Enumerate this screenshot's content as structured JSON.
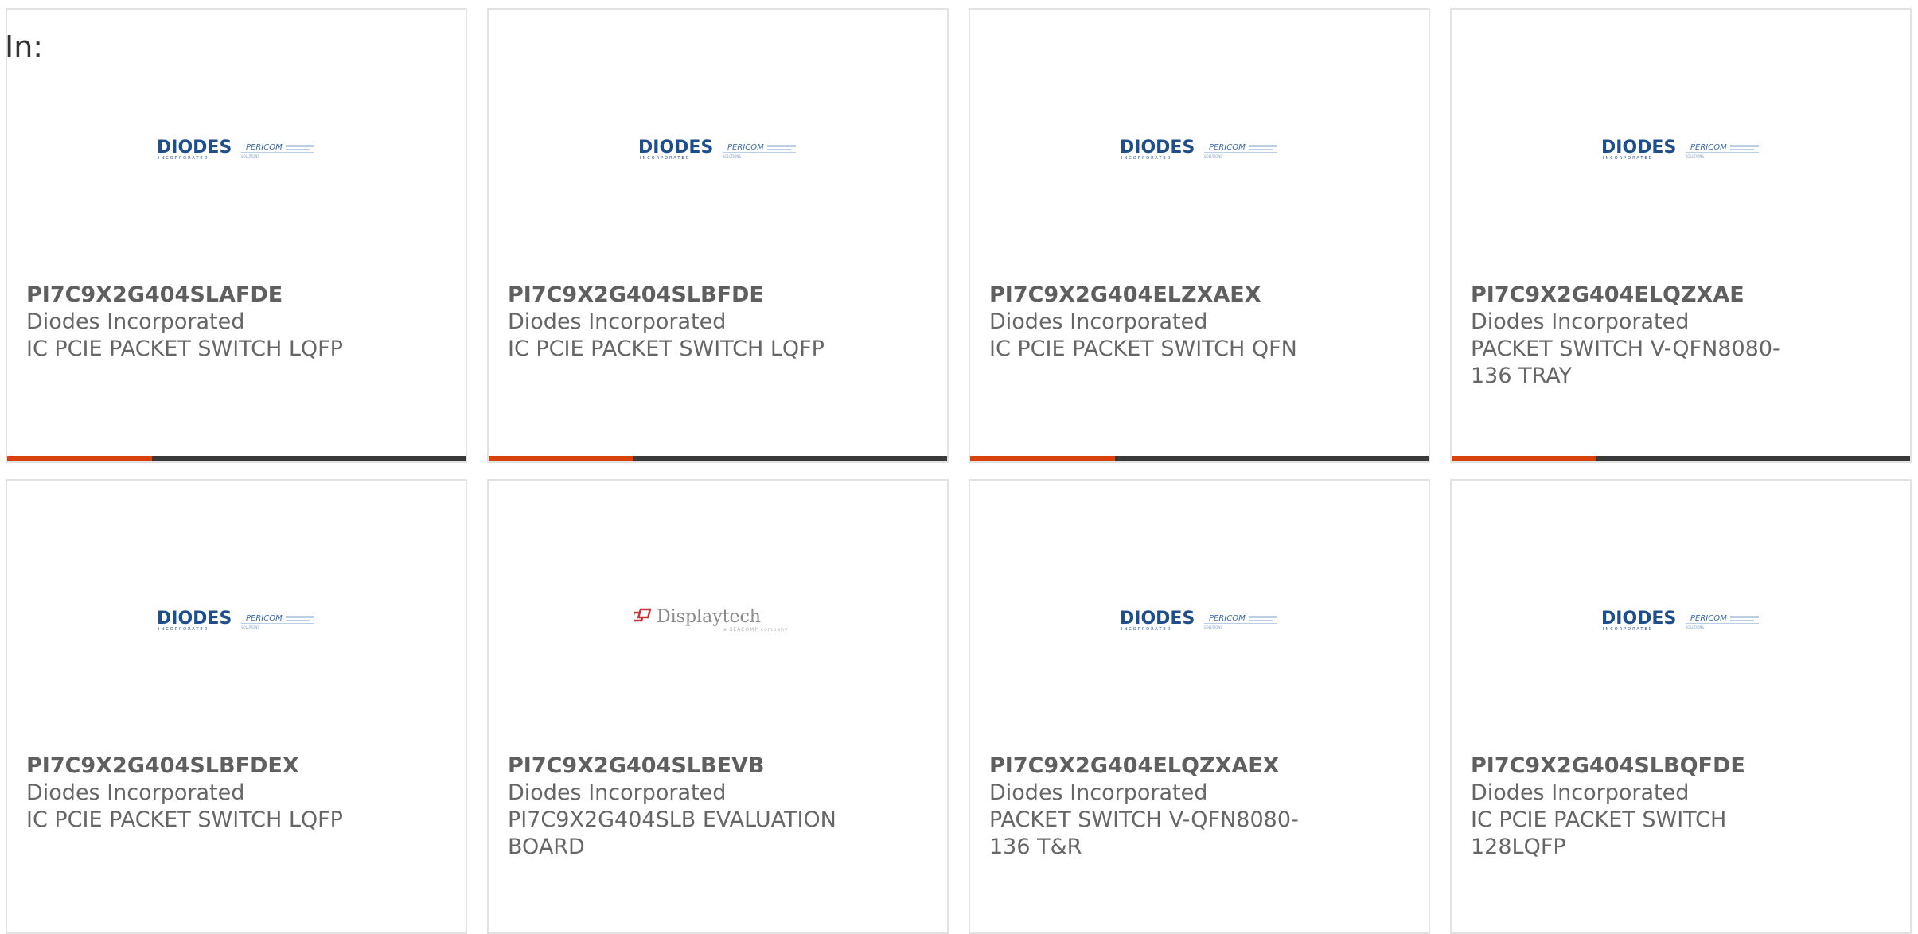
{
  "header": {
    "in_label": "In:"
  },
  "colors": {
    "accent_bar": "#d9400c",
    "dark_bar": "#3a3a3a",
    "diodes_blue": "#1f4e8c",
    "displaytech_red": "#c8323a"
  },
  "products": [
    {
      "part": "PI7C9X2G404SLAFDE",
      "manufacturer": "Diodes Incorporated",
      "description": "IC PCIE PACKET SWITCH LQFP",
      "logo": "diodes-pericom-logo"
    },
    {
      "part": "PI7C9X2G404SLBFDE",
      "manufacturer": "Diodes Incorporated",
      "description": "IC PCIE PACKET SWITCH LQFP",
      "logo": "diodes-pericom-logo"
    },
    {
      "part": "PI7C9X2G404ELZXAEX",
      "manufacturer": "Diodes Incorporated",
      "description": "IC PCIE PACKET SWITCH QFN",
      "logo": "diodes-pericom-logo"
    },
    {
      "part": "PI7C9X2G404ELQZXAE",
      "manufacturer": "Diodes Incorporated",
      "description": "PACKET SWITCH V-QFN8080-136 TRAY",
      "logo": "diodes-pericom-logo"
    },
    {
      "part": "PI7C9X2G404SLBFDEX",
      "manufacturer": "Diodes Incorporated",
      "description": "IC PCIE PACKET SWITCH LQFP",
      "logo": "diodes-pericom-logo"
    },
    {
      "part": "PI7C9X2G404SLBEVB",
      "manufacturer": "Diodes Incorporated",
      "description": "PI7C9X2G404SLB EVALUATION BOARD",
      "logo": "displaytech-logo"
    },
    {
      "part": "PI7C9X2G404ELQZXAEX",
      "manufacturer": "Diodes Incorporated",
      "description": "PACKET SWITCH V-QFN8080-136 T&R",
      "logo": "diodes-pericom-logo"
    },
    {
      "part": "PI7C9X2G404SLBQFDE",
      "manufacturer": "Diodes Incorporated",
      "description": "IC PCIE PACKET SWITCH 128LQFP",
      "logo": "diodes-pericom-logo"
    }
  ],
  "logos": {
    "diodes": {
      "main": "DIODES",
      "sub": "INCORPORATED",
      "partner": "PERICOM",
      "partner_sub": "SOLUTIONS"
    },
    "displaytech": {
      "main": "Displaytech",
      "sub": "a SEACOMP company"
    }
  }
}
